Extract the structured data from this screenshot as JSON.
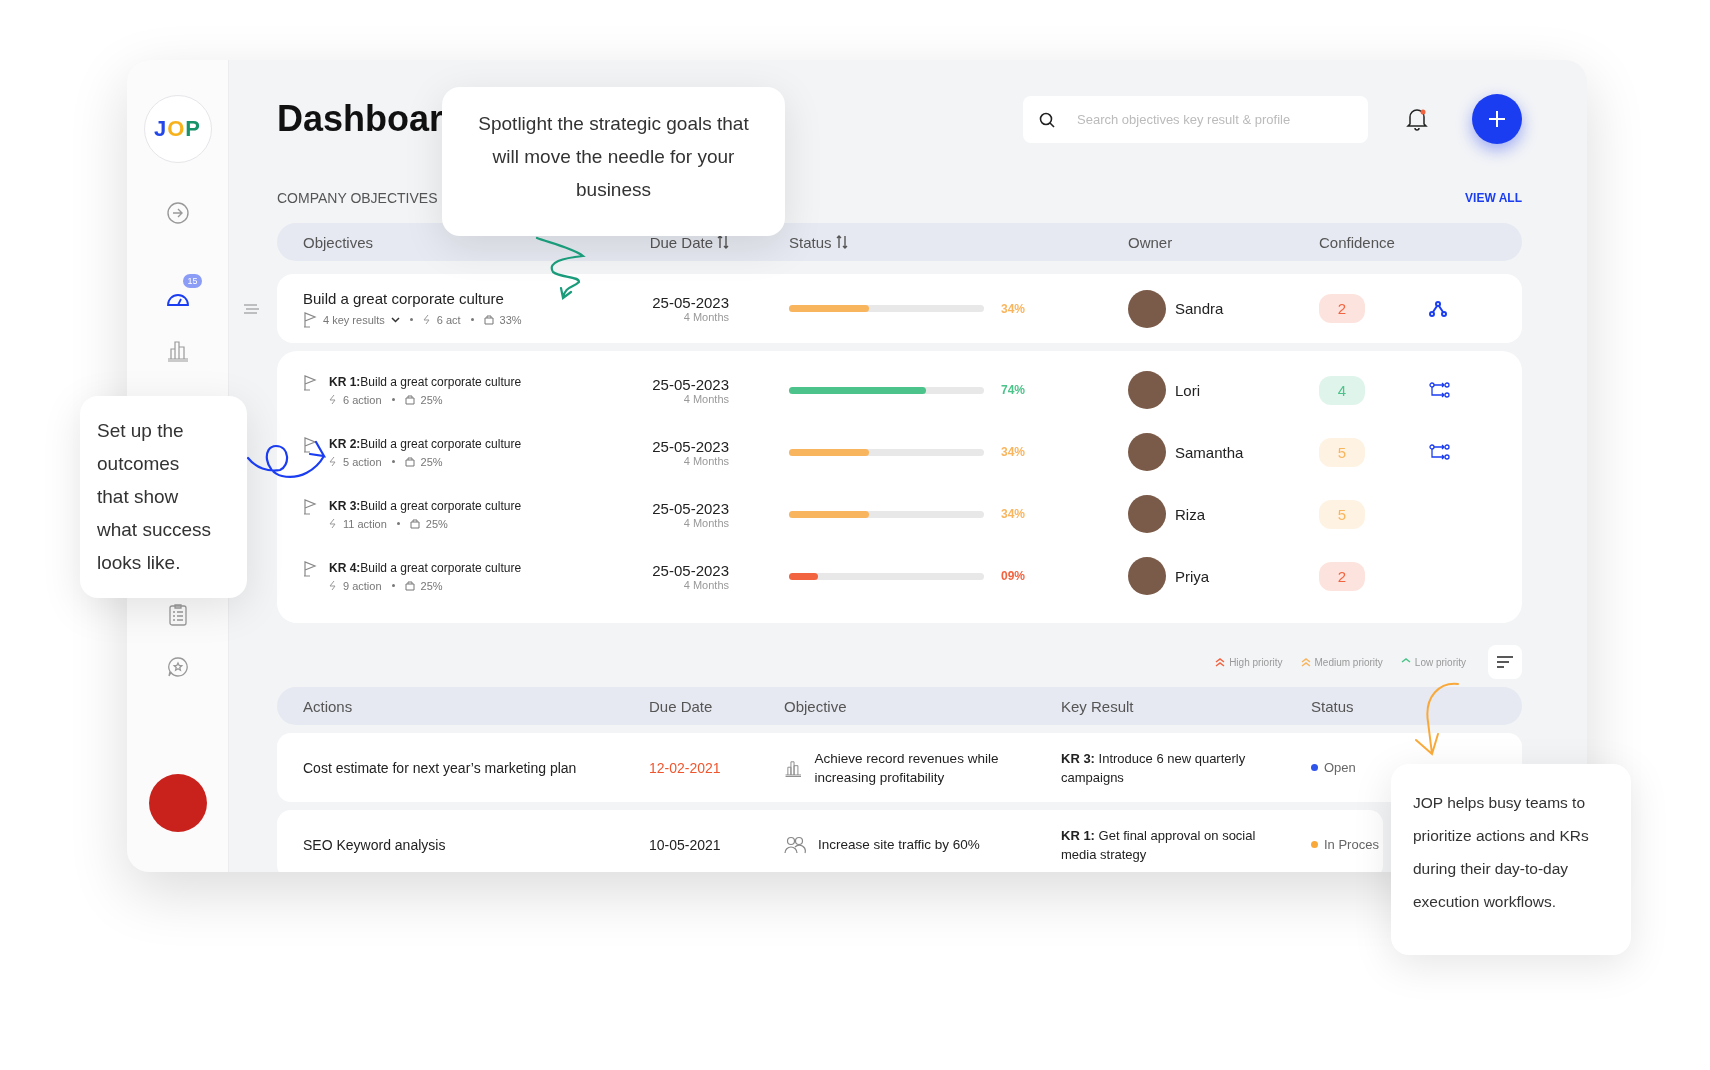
{
  "sidebar": {
    "logo": "JOP",
    "items": [
      {
        "selected": false
      },
      {
        "selected": true,
        "badge": "15"
      },
      {
        "selected": false
      },
      {
        "selected": false
      },
      {
        "selected": false
      }
    ]
  },
  "header": {
    "title": "Dashboar",
    "search": {
      "placeholder": "Search objectives key result & profile"
    },
    "notification_unread": true
  },
  "objectives": {
    "section_title": "COMPANY OBJECTIVES",
    "view_all": "VIEW ALL",
    "columns": [
      "Objectives",
      "Due Date",
      "Status",
      "Owner",
      "Confidence"
    ],
    "objective": {
      "name": "Build a great corporate culture",
      "key_results": "4 key results",
      "actions": "6 act",
      "progress": "33%",
      "due_date": "25-05-2023",
      "duration": "4 Months",
      "level": 0.41,
      "percent": "34%",
      "color": "#f9b55d",
      "owner": "Sandra",
      "confidence": {
        "value": "2",
        "color": "#f26440"
      }
    },
    "key_results": [
      {
        "title": "**KR 1:**Build a great corporate culture",
        "actions": "6 action",
        "progress": "25%",
        "due_date": "25-05-2023",
        "duration": "4 Months",
        "level": 0.7,
        "percent": "74%",
        "color": "#4cc38a",
        "owner": "Lori",
        "confidence": {
          "value": "4",
          "color": "#4cc38a"
        },
        "linked": true
      },
      {
        "title": "**KR 2:**Build a great corporate culture",
        "actions": "5 action",
        "progress": "25%",
        "due_date": "25-05-2023",
        "duration": "4 Months",
        "level": 0.41,
        "percent": "34%",
        "color": "#f9b55d",
        "owner": "Samantha",
        "confidence": {
          "value": "5",
          "color": "#f9b55d"
        },
        "linked": true
      },
      {
        "title": "**KR 3:**Build a great corporate culture",
        "actions": "11 action",
        "progress": "25%",
        "due_date": "25-05-2023",
        "duration": "4 Months",
        "level": 0.41,
        "percent": "34%",
        "color": "#f9b55d",
        "owner": "Riza",
        "confidence": {
          "value": "5",
          "color": "#f9b55d"
        },
        "linked": false
      },
      {
        "title": "**KR 4:**Build a great corporate culture",
        "actions": "9 action",
        "progress": "25%",
        "due_date": "25-05-2023",
        "duration": "4 Months",
        "level": 0.15,
        "percent": "09%",
        "color": "#f26440",
        "owner": "Priya",
        "confidence": {
          "value": "2",
          "color": "#f26440"
        },
        "linked": false
      }
    ]
  },
  "legend": [
    {
      "label": "High priority",
      "color": "#f26440"
    },
    {
      "label": "Medium priority",
      "color": "#f9b55d"
    },
    {
      "label": "Low priority",
      "color": "#4cc38a"
    }
  ],
  "actions": {
    "columns": [
      "Actions",
      "Due Date",
      "Objective",
      "Key Result",
      "Status"
    ],
    "rows": [
      {
        "action": "Cost estimate for next year’s marketing plan",
        "due_date": "12-02-2021",
        "overdue": true,
        "objective": "Achieve record revenues while increasing profitability",
        "key_result": "**KR 3:** Introduce 6 new quarterly campaigns",
        "status": "Open",
        "color": "#2f54eb"
      },
      {
        "action": "SEO Keyword analysis",
        "due_date": "10-05-2021",
        "overdue": false,
        "objective": "Increase site traffic by 60%",
        "key_result": "**KR 1:** Get final approval on social media strategy",
        "status": "In Proces",
        "color": "#f9a93a"
      }
    ]
  },
  "callouts": [
    {
      "text": "Spotlight the strategic goals that will move the needle for your business"
    },
    {
      "text": "Set up the outcomes that show what success looks like."
    },
    {
      "text": "JOP helps busy teams to prioritize actions and KRs during their day-to-day execution workflows."
    }
  ]
}
